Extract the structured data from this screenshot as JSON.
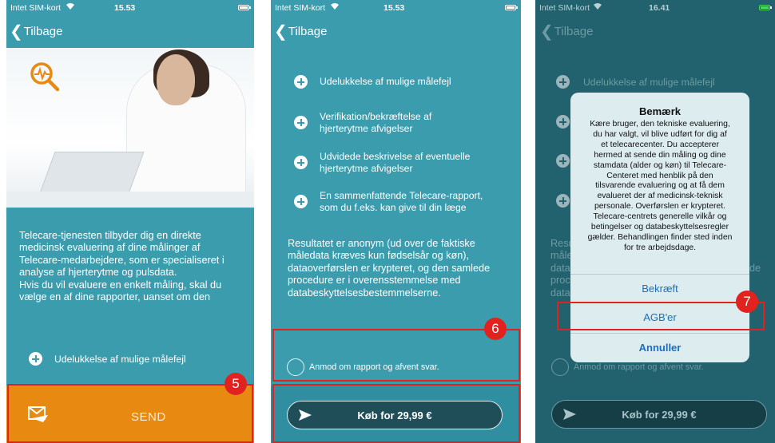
{
  "colors": {
    "teal": "#3b9cad",
    "teal_dark": "#22626e",
    "orange": "#e88a12",
    "button_dark": "#1f4e59",
    "annotation_red": "#e2221f",
    "link_blue": "#1b6fbd"
  },
  "screen1": {
    "status": {
      "carrier": "Intet SIM-kort",
      "time": "15.53"
    },
    "back_label": "Tilbage",
    "hero_icon": "magnifier-heartbeat-icon",
    "paragraph": [
      "Telecare-tjenesten tilbyder dig en direkte",
      "medicinsk evaluering af dine målinger af",
      "Telecare-medarbejdere, som er specialiseret i",
      "analyse af hjerterytme og pulsdata.",
      "Hvis du vil evaluere en enkelt måling, skal du",
      "vælge en af dine rapporter, uanset om den"
    ],
    "feature_item": "Udelukkelse af mulige målefejl",
    "send_label": "SEND",
    "send_icon": "envelope-send-icon",
    "annotation": "5"
  },
  "screen2": {
    "status": {
      "carrier": "Intet SIM-kort",
      "time": "15.53"
    },
    "back_label": "Tilbage",
    "features": [
      [
        "Udelukkelse af mulige målefejl"
      ],
      [
        "Verifikation/bekræftelse af",
        "hjerterytme afvigelser"
      ],
      [
        "Udvidede beskrivelse af eventuelle",
        "hjerterytme afvigelser"
      ],
      [
        "En sammenfattende Telecare-rapport,",
        "som du f.eks. kan give til din læge"
      ]
    ],
    "paragraph": [
      "Resultatet er anonym (ud over de faktiske",
      "måledata kræves kun fødselsår og køn),",
      "dataoverførslen er krypteret, og den samlede",
      "procedure er i overensstemmelse med",
      "databeskyttelsesbestemmelserne."
    ],
    "radio_label": "Anmod om rapport og afvent svar.",
    "buy_label": "Køb for 29,99 €",
    "annotation": "6"
  },
  "screen3": {
    "status": {
      "carrier": "Intet SIM-kort",
      "time": "16.41"
    },
    "back_label": "Tilbage",
    "features_visible": [
      "Udelukkelse af mulige målefejl"
    ],
    "bg_fragments": [
      "Resu",
      "måle",
      "data",
      "proc",
      "data"
    ],
    "bg_fragment_right": "de",
    "radio_label": "Anmod om rapport og afvent svar.",
    "buy_label": "Køb for 29,99 €",
    "dialog": {
      "title": "Bemærk",
      "body": [
        "Kære bruger, den tekniske evaluering,",
        "du har valgt, vil blive udført for dig af",
        "et telecarecenter. Du accepterer",
        "hermed at sende din måling og dine",
        "stamdata (alder og køn) til Telecare-",
        "Centeret med henblik på den",
        "tilsvarende evaluering og at få dem",
        "evalueret der af medicinsk-teknisk",
        "personale. Overførslen er krypteret.",
        "Telecare-centrets generelle vilkår og",
        "betingelser og databeskyttelsesregler",
        "gælder. Behandlingen finder sted inden",
        "for tre arbejdsdage."
      ],
      "confirm": "Bekræft",
      "terms": "AGB'er",
      "cancel": "Annuller"
    },
    "annotation": "7"
  }
}
